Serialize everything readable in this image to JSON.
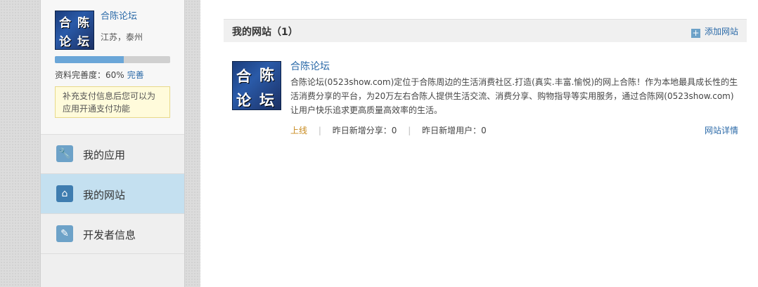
{
  "profile": {
    "name": "合陈论坛",
    "location": "江苏，泰州",
    "progress_percent": 60,
    "completeness_label": "资料完善度：60%",
    "complete_link": "完善",
    "notice": "补充支付信息后您可以为应用开通支付功能",
    "avatar_chars": [
      "合",
      "陈",
      "论",
      "坛"
    ]
  },
  "sidebar": {
    "items": [
      {
        "label": "我的应用",
        "icon": "wrench-icon",
        "active": false
      },
      {
        "label": "我的网站",
        "icon": "home-icon",
        "active": true
      },
      {
        "label": "开发者信息",
        "icon": "edit-icon",
        "active": false
      }
    ]
  },
  "main": {
    "panel_title": "我的网站（1）",
    "add_site_label": "添加网站",
    "site": {
      "title": "合陈论坛",
      "description": "合陈论坛(0523show.com)定位于合陈周边的生活消费社区.打造(真实.丰富.愉悦)的网上合陈！作为本地最具成长性的生活消费分享的平台，为20万左右合陈人提供生活交流、消费分享、购物指导等实用服务，通过合陈网(0523show.com)让用户快乐追求更高质量高效率的生活。",
      "status": "上线",
      "new_shares": "昨日新增分享：0",
      "new_users": "昨日新增用户：0",
      "detail_link": "网站详情",
      "logo_chars": [
        "合",
        "陈",
        "论",
        "坛"
      ]
    }
  },
  "colors": {
    "link": "#2b6aa8",
    "active_nav": "#c4e0f0",
    "status_online": "#c88a1e",
    "progress_fill": "#6aa6d8"
  }
}
